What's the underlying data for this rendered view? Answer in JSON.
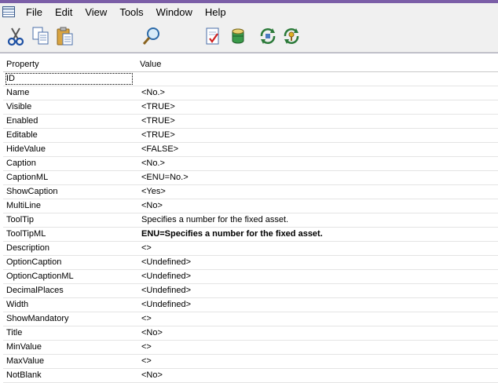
{
  "menu": [
    "File",
    "Edit",
    "View",
    "Tools",
    "Window",
    "Help"
  ],
  "toolbar_icons": [
    "cut-icon",
    "copy-icon",
    "paste-icon",
    "find-icon",
    "checklist-icon",
    "database-icon",
    "refresh-icon",
    "key-refresh-icon"
  ],
  "grid": {
    "header": {
      "property": "Property",
      "value": "Value"
    },
    "rows": [
      {
        "property": "ID",
        "value": ""
      },
      {
        "property": "Name",
        "value": "<No.>"
      },
      {
        "property": "Visible",
        "value": "<TRUE>"
      },
      {
        "property": "Enabled",
        "value": "<TRUE>"
      },
      {
        "property": "Editable",
        "value": "<TRUE>"
      },
      {
        "property": "HideValue",
        "value": "<FALSE>"
      },
      {
        "property": "Caption",
        "value": "<No.>"
      },
      {
        "property": "CaptionML",
        "value": "<ENU=No.>"
      },
      {
        "property": "ShowCaption",
        "value": "<Yes>"
      },
      {
        "property": "MultiLine",
        "value": "<No>"
      },
      {
        "property": "ToolTip",
        "value": "Specifies a number for the fixed asset."
      },
      {
        "property": "ToolTipML",
        "value": "ENU=Specifies a number for the fixed asset."
      },
      {
        "property": "Description",
        "value": "<>"
      },
      {
        "property": "OptionCaption",
        "value": "<Undefined>"
      },
      {
        "property": "OptionCaptionML",
        "value": "<Undefined>"
      },
      {
        "property": "DecimalPlaces",
        "value": "<Undefined>"
      },
      {
        "property": "Width",
        "value": "<Undefined>"
      },
      {
        "property": "ShowMandatory",
        "value": "<>"
      },
      {
        "property": "Title",
        "value": "<No>"
      },
      {
        "property": "MinValue",
        "value": "<>"
      },
      {
        "property": "MaxValue",
        "value": "<>"
      },
      {
        "property": "NotBlank",
        "value": "<No>"
      }
    ]
  }
}
